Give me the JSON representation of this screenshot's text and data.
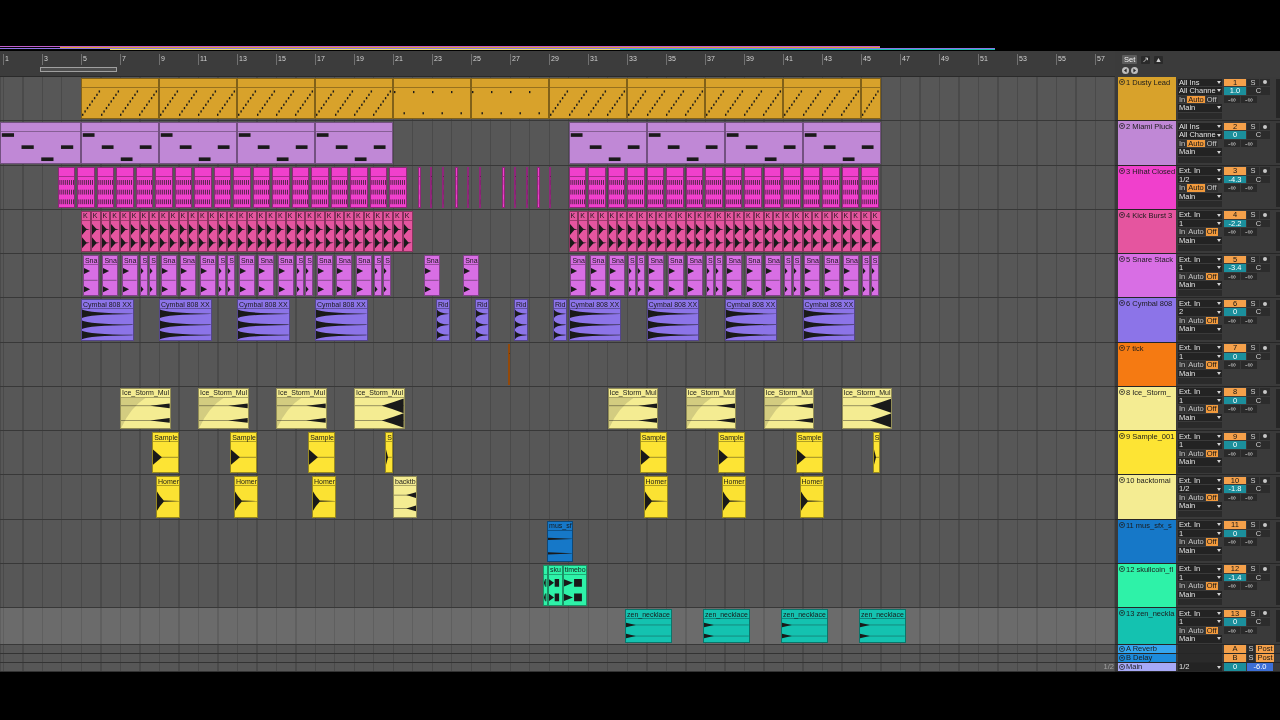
{
  "ruler": {
    "bars": [
      "1",
      "3",
      "5",
      "7",
      "9",
      "11",
      "13",
      "15",
      "17",
      "19",
      "21",
      "23",
      "25",
      "27",
      "29",
      "31",
      "33",
      "35",
      "37",
      "39",
      "41",
      "43",
      "45",
      "47",
      "49",
      "51",
      "53",
      "55",
      "57"
    ]
  },
  "header": {
    "set_button": "Set"
  },
  "tracks": [
    {
      "name": "1 Dusty Lead",
      "color": "#d8a22b",
      "kind": "midi",
      "selected": false,
      "input_type": "All Ins",
      "input_channel": "All Channe",
      "monitor": [
        {
          "label": "In",
          "selected": false
        },
        {
          "label": "Auto",
          "selected": true
        },
        {
          "label": "Off",
          "selected": false
        }
      ],
      "output": "Main",
      "number": "1",
      "solo": "S",
      "volume": "1.0",
      "pan": "C",
      "peaks": [
        "-∞",
        "-∞"
      ]
    },
    {
      "name": "2 Miami Pluck",
      "color": "#c088d6",
      "kind": "midi",
      "selected": false,
      "input_type": "All Ins",
      "input_channel": "All Channe",
      "monitor": [
        {
          "label": "In",
          "selected": false
        },
        {
          "label": "Auto",
          "selected": true
        },
        {
          "label": "Off",
          "selected": false
        }
      ],
      "output": "Main",
      "number": "2",
      "solo": "S",
      "volume": "0",
      "pan": "C",
      "peaks": [
        "-∞",
        "-∞"
      ]
    },
    {
      "name": "3 Hihat Closed",
      "color": "#f040cc",
      "kind": "audio",
      "selected": false,
      "input_type": "Ext. In",
      "input_channel": "1/2",
      "monitor": [
        {
          "label": "In",
          "selected": false
        },
        {
          "label": "Auto",
          "selected": true
        },
        {
          "label": "Off",
          "selected": false
        }
      ],
      "output": "Main",
      "number": "3",
      "solo": "S",
      "volume": "-4.3",
      "pan": "C",
      "peaks": [
        "-∞",
        "-∞"
      ]
    },
    {
      "name": "4 Kick Burst 3",
      "color": "#e5559f",
      "kind": "audio",
      "selected": false,
      "input_type": "Ext. In",
      "input_channel": "1",
      "monitor": [
        {
          "label": "In",
          "selected": false
        },
        {
          "label": "Auto",
          "selected": false
        },
        {
          "label": "Off",
          "selected": true
        }
      ],
      "output": "Main",
      "number": "4",
      "solo": "S",
      "volume": "-2.2",
      "pan": "C",
      "peaks": [
        "-∞",
        "-∞"
      ],
      "clips": [
        {
          "label": "K"
        },
        {
          "label": "K"
        },
        {
          "label": "K"
        },
        {
          "label": "K"
        },
        {
          "label": "K"
        },
        {
          "label": "K"
        },
        {
          "label": "K"
        },
        {
          "label": "K"
        },
        {
          "label": "K"
        },
        {
          "label": "K"
        },
        {
          "label": "K"
        },
        {
          "label": "K"
        },
        {
          "label": "K"
        },
        {
          "label": "K"
        },
        {
          "label": "K"
        },
        {
          "label": "K"
        },
        {
          "label": "K"
        },
        {
          "label": "K"
        },
        {
          "label": "K"
        },
        {
          "label": "K"
        },
        {
          "label": "K"
        },
        {
          "label": "K"
        },
        {
          "label": "K"
        },
        {
          "label": "K"
        },
        {
          "label": "K"
        },
        {
          "label": "K"
        },
        {
          "label": "K"
        },
        {
          "label": "K"
        },
        {
          "label": "K"
        },
        {
          "label": "K"
        },
        {
          "label": "K"
        },
        {
          "label": "K"
        },
        {
          "label": "K"
        },
        {
          "label": "K"
        },
        {
          "label": "K"
        },
        {
          "label": "K"
        },
        {
          "label": "K"
        },
        {
          "label": "K"
        },
        {
          "label": "K"
        },
        {
          "label": "K"
        },
        {
          "label": "K"
        },
        {
          "label": "K"
        },
        {
          "label": "K"
        },
        {
          "label": "K"
        },
        {
          "label": "K"
        },
        {
          "label": "K"
        },
        {
          "label": "K"
        },
        {
          "label": "K"
        },
        {
          "label": "K"
        },
        {
          "label": "K"
        },
        {
          "label": "K"
        },
        {
          "label": "K"
        },
        {
          "label": "K"
        },
        {
          "label": "K"
        },
        {
          "label": "K"
        },
        {
          "label": "K"
        },
        {
          "label": "K"
        },
        {
          "label": "K"
        },
        {
          "label": "K"
        },
        {
          "label": "K"
        },
        {
          "label": "K"
        },
        {
          "label": "K"
        },
        {
          "label": "K"
        },
        {
          "label": "K"
        },
        {
          "label": "K"
        },
        {
          "label": "K"
        }
      ]
    },
    {
      "name": "5 Snare Stack",
      "color": "#d86ee4",
      "kind": "audio",
      "selected": false,
      "input_type": "Ext. In",
      "input_channel": "1",
      "monitor": [
        {
          "label": "In",
          "selected": false
        },
        {
          "label": "Auto",
          "selected": false
        },
        {
          "label": "Off",
          "selected": true
        }
      ],
      "output": "Main",
      "number": "5",
      "solo": "S",
      "volume": "-3.4",
      "pan": "C",
      "peaks": [
        "-∞",
        "-∞"
      ],
      "clips": [
        {
          "label": "Sna"
        },
        {
          "label": "Sna"
        },
        {
          "label": "Sna"
        },
        {
          "label": "S"
        },
        {
          "label": "S"
        },
        {
          "label": "Sna"
        },
        {
          "label": "Sna"
        },
        {
          "label": "Sna"
        },
        {
          "label": "S"
        },
        {
          "label": "S"
        },
        {
          "label": "Sna"
        },
        {
          "label": "Sna"
        },
        {
          "label": "Sna"
        },
        {
          "label": "S"
        },
        {
          "label": "S"
        },
        {
          "label": "Sna"
        },
        {
          "label": "Sna"
        },
        {
          "label": "Sna"
        },
        {
          "label": "S"
        },
        {
          "label": "S"
        },
        {
          "label": "Sna"
        },
        {
          "label": "Sna"
        },
        {
          "label": "Sna"
        },
        {
          "label": "Sna"
        },
        {
          "label": "Sna"
        },
        {
          "label": "S"
        },
        {
          "label": "S"
        },
        {
          "label": "Sna"
        },
        {
          "label": "Sna"
        },
        {
          "label": "Sna"
        },
        {
          "label": "S"
        },
        {
          "label": "S"
        },
        {
          "label": "Sna"
        },
        {
          "label": "Sna"
        },
        {
          "label": "Sna"
        },
        {
          "label": "S"
        },
        {
          "label": "S"
        },
        {
          "label": "Sna"
        },
        {
          "label": "Sna"
        },
        {
          "label": "Sna"
        },
        {
          "label": "S"
        },
        {
          "label": "S"
        }
      ]
    },
    {
      "name": "6 Cymbal 808",
      "color": "#8c74e8",
      "kind": "audio",
      "selected": false,
      "input_type": "Ext. In",
      "input_channel": "2",
      "monitor": [
        {
          "label": "In",
          "selected": false
        },
        {
          "label": "Auto",
          "selected": false
        },
        {
          "label": "Off",
          "selected": true
        }
      ],
      "output": "Main",
      "number": "6",
      "solo": "S",
      "volume": "0",
      "pan": "C",
      "peaks": [
        "-∞",
        "-∞"
      ],
      "clips": [
        {
          "label": "Cymbal 808 XX"
        },
        {
          "label": "Cymbal 808 XX"
        },
        {
          "label": "Cymbal 808 XX"
        },
        {
          "label": "Cymbal 808 XX"
        },
        {
          "label": "Rid"
        },
        {
          "label": "Rid"
        },
        {
          "label": "Rid"
        },
        {
          "label": "Rid"
        },
        {
          "label": "Cymbal 808 XX"
        },
        {
          "label": "Cymbal 808 XX"
        },
        {
          "label": "Cymbal 808 XX"
        },
        {
          "label": "Cymbal 808 XX"
        }
      ]
    },
    {
      "name": "7 tick",
      "color": "#f57a12",
      "kind": "audio",
      "selected": false,
      "input_type": "Ext. In",
      "input_channel": "1",
      "monitor": [
        {
          "label": "In",
          "selected": false
        },
        {
          "label": "Auto",
          "selected": false
        },
        {
          "label": "Off",
          "selected": true
        }
      ],
      "output": "Main",
      "number": "7",
      "solo": "S",
      "volume": "0",
      "pan": "C",
      "peaks": [
        "-∞",
        "-∞"
      ]
    },
    {
      "name": "8 Ice_Storm_",
      "color": "#f4ec92",
      "kind": "audio",
      "selected": false,
      "input_type": "Ext. In",
      "input_channel": "1",
      "monitor": [
        {
          "label": "In",
          "selected": false
        },
        {
          "label": "Auto",
          "selected": false
        },
        {
          "label": "Off",
          "selected": true
        }
      ],
      "output": "Main",
      "number": "8",
      "solo": "S",
      "volume": "0",
      "pan": "C",
      "peaks": [
        "-∞",
        "-∞"
      ],
      "clips": [
        {
          "label": "Ice_Storm_Mul"
        },
        {
          "label": "Ice_Storm_Mul"
        },
        {
          "label": "Ice_Storm_Mul"
        },
        {
          "label": "Ice_Storm_Mul"
        },
        {
          "label": "Ice_Storm_Mul"
        },
        {
          "label": "Ice_Storm_Mul"
        },
        {
          "label": "Ice_Storm_Mul"
        },
        {
          "label": "Ice_Storm_Mul"
        }
      ]
    },
    {
      "name": "9 Sample_001",
      "color": "#fde434",
      "kind": "audio",
      "selected": false,
      "input_type": "Ext. In",
      "input_channel": "1",
      "monitor": [
        {
          "label": "In",
          "selected": false
        },
        {
          "label": "Auto",
          "selected": false
        },
        {
          "label": "Off",
          "selected": true
        }
      ],
      "output": "Main",
      "number": "9",
      "solo": "S",
      "volume": "0",
      "pan": "C",
      "peaks": [
        "-∞",
        "-∞"
      ],
      "clips": [
        {
          "label": "Sample"
        },
        {
          "label": "Sample"
        },
        {
          "label": "Sample"
        },
        {
          "label": "S"
        },
        {
          "label": "Sample"
        },
        {
          "label": "Sample"
        },
        {
          "label": "Sample"
        },
        {
          "label": "S"
        }
      ]
    },
    {
      "name": "10 backtomai",
      "color": "#f4ec92",
      "kind": "audio",
      "selected": false,
      "input_type": "Ext. In",
      "input_channel": "1/2",
      "monitor": [
        {
          "label": "In",
          "selected": false
        },
        {
          "label": "Auto",
          "selected": false
        },
        {
          "label": "Off",
          "selected": true
        }
      ],
      "output": "Main",
      "number": "10",
      "solo": "S",
      "volume": "-1.8",
      "pan": "C",
      "peaks": [
        "-∞",
        "-∞"
      ],
      "clips": [
        {
          "label": "Homer",
          "color": "#fbe232"
        },
        {
          "label": "Homer",
          "color": "#fbe232"
        },
        {
          "label": "Homer",
          "color": "#fbe232"
        },
        {
          "label": "backtb",
          "color": "#f4ec92"
        },
        {
          "label": "Homer",
          "color": "#fbe232"
        },
        {
          "label": "Homer",
          "color": "#fbe232"
        },
        {
          "label": "Homer",
          "color": "#fbe232"
        }
      ]
    },
    {
      "name": "11 mus_sfx_s",
      "color": "#1678c8",
      "kind": "audio",
      "selected": false,
      "input_type": "Ext. In",
      "input_channel": "1",
      "monitor": [
        {
          "label": "In",
          "selected": false
        },
        {
          "label": "Auto",
          "selected": false
        },
        {
          "label": "Off",
          "selected": true
        }
      ],
      "output": "Main",
      "number": "11",
      "solo": "S",
      "volume": "0",
      "pan": "C",
      "peaks": [
        "-∞",
        "-∞"
      ],
      "clips": [
        {
          "label": "mus_sf"
        }
      ]
    },
    {
      "name": "12 skullcoin_fl",
      "color": "#2ef2a8",
      "kind": "audio",
      "selected": false,
      "input_type": "Ext. In",
      "input_channel": "1",
      "monitor": [
        {
          "label": "In",
          "selected": false
        },
        {
          "label": "Auto",
          "selected": false
        },
        {
          "label": "Off",
          "selected": true
        }
      ],
      "output": "Main",
      "number": "12",
      "solo": "S",
      "volume": "-1.4",
      "pan": "C",
      "peaks": [
        "-∞",
        "-∞"
      ],
      "clips": [
        {
          "label": "sku"
        },
        {
          "label": "timebo"
        }
      ]
    },
    {
      "name": "13 zen_neckla",
      "color": "#14c2b0",
      "kind": "audio",
      "selected": true,
      "input_type": "Ext. In",
      "input_channel": "1",
      "monitor": [
        {
          "label": "In",
          "selected": false
        },
        {
          "label": "Auto",
          "selected": false
        },
        {
          "label": "Off",
          "selected": true
        }
      ],
      "output": "Main",
      "number": "13",
      "solo": "S",
      "volume": "0",
      "pan": "C",
      "peaks": [
        "-∞",
        "-∞"
      ],
      "clips": [
        {
          "label": "zen_necklace"
        },
        {
          "label": "zen_necklace"
        },
        {
          "label": "zen_necklace"
        },
        {
          "label": "zen_necklace"
        }
      ]
    }
  ],
  "returns": [
    {
      "name": "A Reverb",
      "color": "#36a6ee",
      "number": "A",
      "solo": "S",
      "send_mode": "Post"
    },
    {
      "name": "B Delay",
      "color": "#1d8cdc",
      "number": "B",
      "solo": "S",
      "send_mode": "Post"
    }
  ],
  "main": {
    "name": "Main",
    "color": "#a7a9f7",
    "output": "1/2",
    "volume": "0",
    "cue_volume": "-6.0",
    "corner_label": "1/2"
  }
}
